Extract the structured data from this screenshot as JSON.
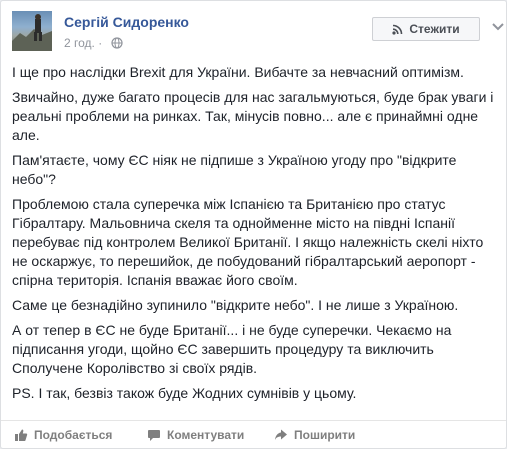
{
  "post": {
    "author": "Сергій Сидоренко",
    "time": "2 год.",
    "follow_label": "Стежити",
    "paragraphs": [
      "І ще про наслідки Brexit для України. Вибачте за невчасний оптимізм.",
      "Звичайно, дуже багато процесів для нас загальмуються, буде брак уваги і реальні проблеми на ринках. Так, мінусів повно... але є принаймні одне але.",
      "Пам'ятаєте, чому ЄС ніяк не підпише з Україною угоду про \"відкрите небо\"?",
      "Проблемою стала суперечка між Іспанією та Британією про статус Гібралтару. Мальовнича скеля та однойменне місто на півдні Іспанії перебуває під контролем Великої Британії. І якщо належність скелі ніхто не оскаржує, то перешийок, де побудований гібралтарський аеропорт - спірна територія. Іспанія вважає його своїм.",
      "Саме це безнадійно зупинило \"відкрите небо\". І не лише з Україною.",
      "А от тепер в ЄС не буде Британії... і не буде суперечки. Чекаємо на підписання угоди, щойно ЄС завершить процедуру та виключить Сполучене Королівство зі своїх рядів.",
      "PS. І так, безвіз також буде Жодних сумнівів у цьому."
    ]
  },
  "actions": {
    "like": "Подобається",
    "comment": "Коментувати",
    "share": "Поширити"
  },
  "icons": {
    "follow": "rss-icon",
    "privacy": "globe-icon",
    "menu": "chevron-down-icon",
    "like": "thumbs-up-icon",
    "comment": "speech-bubble-icon",
    "share": "share-arrow-icon"
  },
  "colors": {
    "link": "#365899",
    "text": "#1d2129",
    "muted": "#90949c",
    "action": "#7f7f7f"
  }
}
